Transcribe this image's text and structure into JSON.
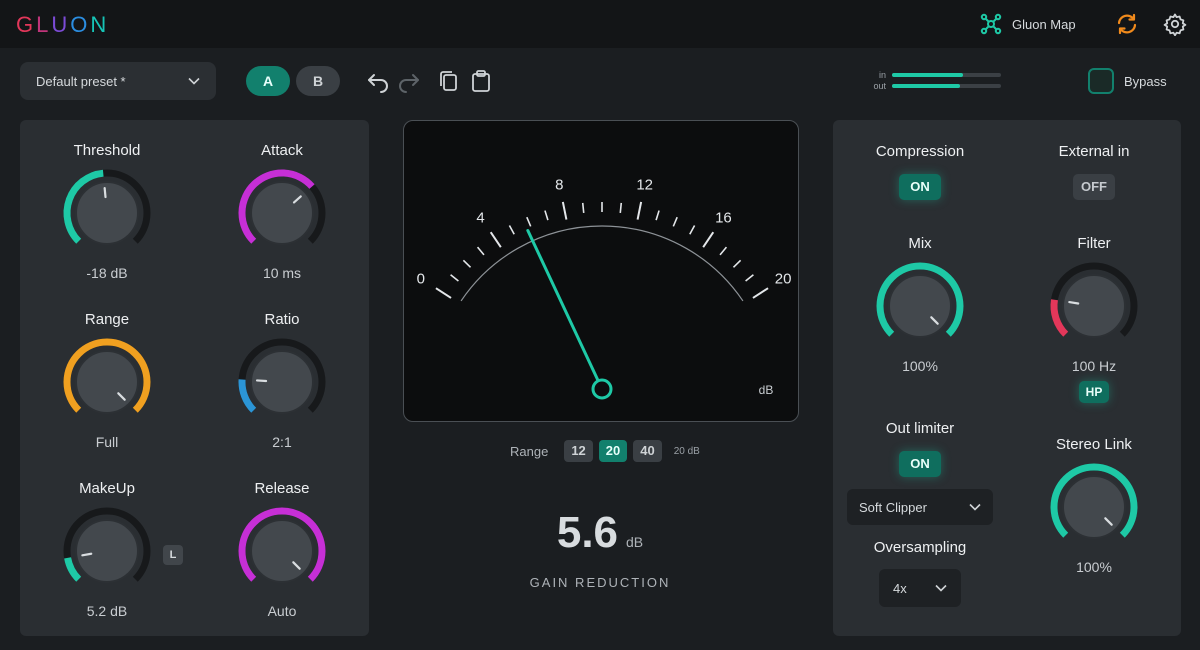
{
  "header": {
    "logo_letters": [
      "G",
      "L",
      "U",
      "O",
      "N"
    ],
    "map_label": "Gluon Map",
    "icons": [
      "gluon-map-icon",
      "sync-icon",
      "settings-gear-icon"
    ]
  },
  "toolbar": {
    "preset": "Default preset *",
    "a_label": "A",
    "b_label": "B",
    "icons": [
      "undo-icon",
      "redo-icon",
      "copy-icon",
      "paste-icon"
    ],
    "meter_in_label": "in",
    "meter_out_label": "out",
    "meter_in_level": 0.65,
    "meter_out_level": 0.62,
    "bypass_label": "Bypass"
  },
  "left_panel": {
    "threshold": {
      "title": "Threshold",
      "value": "-18 dB",
      "level": 0.48,
      "color": "#1ec9a6"
    },
    "attack": {
      "title": "Attack",
      "value": "10 ms",
      "level": 0.68,
      "color": "#c62fd6"
    },
    "range": {
      "title": "Range",
      "value": "Full",
      "level": 1.0,
      "color": "#f0a020"
    },
    "ratio": {
      "title": "Ratio",
      "value": "2:1",
      "level": 0.18,
      "color": "#2b95d6"
    },
    "makeup": {
      "title": "MakeUp",
      "value": "5.2 dB",
      "level": 0.13,
      "color": "#1ec9a6"
    },
    "release": {
      "title": "Release",
      "value": "Auto",
      "level": 1.0,
      "color": "#c62fd6"
    },
    "makeup_badge": "L"
  },
  "meter": {
    "scale_labels": [
      "0",
      "4",
      "8",
      "12",
      "16",
      "20"
    ],
    "unit": "dB",
    "needle_value": 5.6,
    "scale_max": 20,
    "range_label": "Range",
    "range_options": [
      "12",
      "20",
      "40"
    ],
    "range_selected": "20",
    "range_unit": "20 dB",
    "gain_reduction_value": "5.6",
    "gain_reduction_unit": "dB",
    "gain_reduction_label": "GAIN REDUCTION"
  },
  "right_panel": {
    "compression": {
      "title": "Compression",
      "state": "ON"
    },
    "external_in": {
      "title": "External in",
      "state": "OFF"
    },
    "mix": {
      "title": "Mix",
      "value": "100%",
      "level": 1.0,
      "color": "#1ec9a6"
    },
    "filter": {
      "title": "Filter",
      "value": "100 Hz",
      "level": 0.2,
      "color": "#e3375a",
      "mode": "HP"
    },
    "out_limiter": {
      "title": "Out limiter",
      "state": "ON"
    },
    "limiter_type": "Soft Clipper",
    "oversampling": {
      "title": "Oversampling",
      "value": "4x"
    },
    "stereo_link": {
      "title": "Stereo Link",
      "value": "100%",
      "level": 1.0,
      "color": "#1ec9a6"
    }
  }
}
